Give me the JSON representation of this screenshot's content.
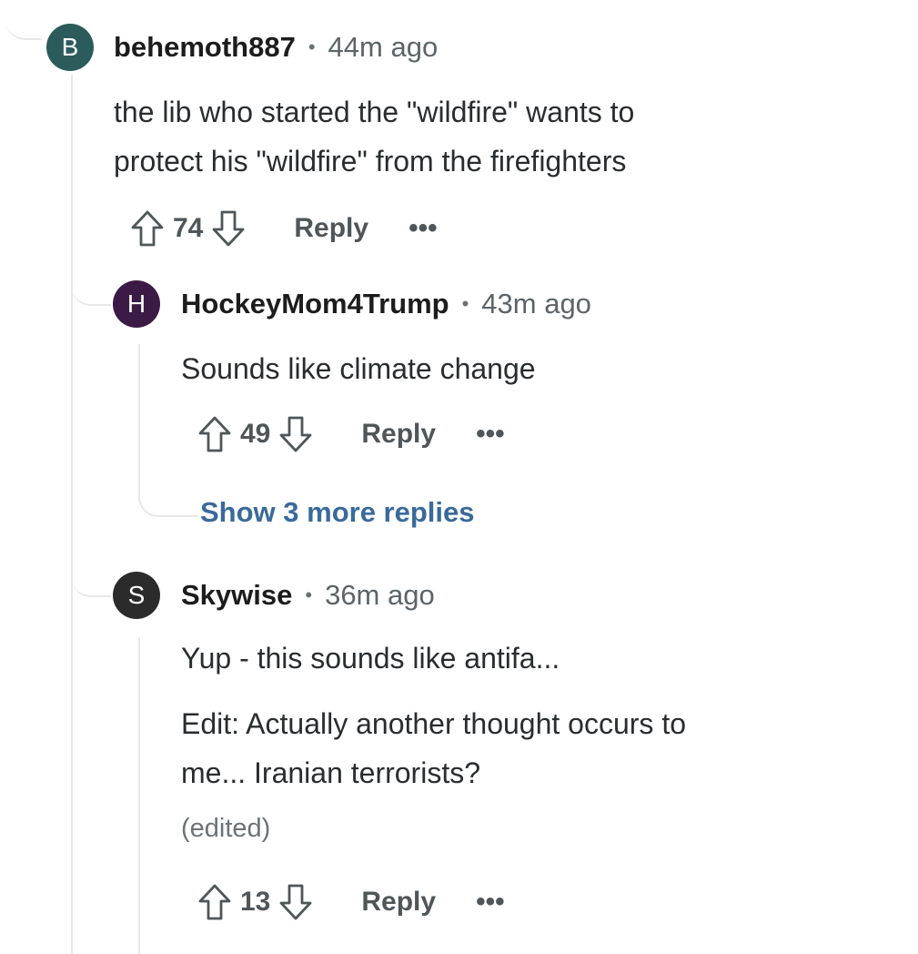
{
  "comments": [
    {
      "avatar_letter": "B",
      "avatar_color": "#2c5b5b",
      "username": "behemoth887",
      "separator": "•",
      "time": "44m ago",
      "body_lines": [
        "the lib who started the \"wildfire\" wants to",
        "protect his \"wildfire\" from the firefighters"
      ],
      "votes": "74",
      "reply_label": "Reply",
      "more_label": "•••"
    },
    {
      "avatar_letter": "H",
      "avatar_color": "#3b1a45",
      "username": "HockeyMom4Trump",
      "separator": "•",
      "time": "43m ago",
      "body_lines": [
        "Sounds like climate change"
      ],
      "votes": "49",
      "reply_label": "Reply",
      "more_label": "•••",
      "show_more_replies": "Show 3 more replies"
    },
    {
      "avatar_letter": "S",
      "avatar_color": "#2b2b2b",
      "username": "Skywise",
      "separator": "•",
      "time": "36m ago",
      "body_lines": [
        "Yup - this sounds like antifa...",
        "Edit: Actually another thought occurs to",
        "me... Iranian terrorists?"
      ],
      "edited": "(edited)",
      "votes": "13",
      "reply_label": "Reply",
      "more_label": "•••"
    }
  ],
  "icons": {
    "upvote": "upvote-arrow-icon",
    "downvote": "downvote-arrow-icon"
  },
  "colors": {
    "link": "#3a6a9a",
    "thread_line": "#e6e8ea",
    "meta_gray": "#5c6468"
  }
}
